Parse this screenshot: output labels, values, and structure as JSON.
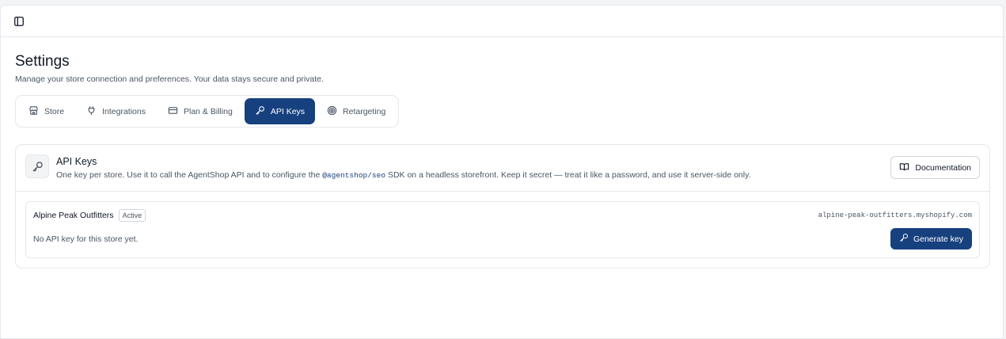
{
  "topbar": {
    "sidebar_toggle_icon": "sidebar-toggle-icon"
  },
  "page": {
    "title": "Settings",
    "subtitle": "Manage your store connection and preferences. Your data stays secure and private."
  },
  "tabs": [
    {
      "label": "Store",
      "icon": "store-icon",
      "active": false
    },
    {
      "label": "Integrations",
      "icon": "plug-icon",
      "active": false
    },
    {
      "label": "Plan & Billing",
      "icon": "credit-card-icon",
      "active": false
    },
    {
      "label": "API Keys",
      "icon": "key-icon",
      "active": true
    },
    {
      "label": "Retargeting",
      "icon": "target-icon",
      "active": false
    }
  ],
  "api_keys": {
    "icon": "key-icon",
    "title": "API Keys",
    "desc_before": "One key per store. Use it to call the AgentShop API and to configure the ",
    "desc_code": "@agentshop/seo",
    "desc_after": " SDK on a headless storefront. Keep it secret — treat it like a password, and use it server-side only.",
    "documentation_label": "Documentation",
    "documentation_icon": "book-open-icon"
  },
  "store": {
    "name": "Alpine Peak Outfitters",
    "status": "Active",
    "domain": "alpine-peak-outfitters.myshopify.com",
    "no_key_text": "No API key for this store yet.",
    "generate_label": "Generate key",
    "generate_icon": "key-icon"
  },
  "colors": {
    "accent": "#17407e",
    "border": "#e5e7eb",
    "muted_text": "#4b5563"
  }
}
